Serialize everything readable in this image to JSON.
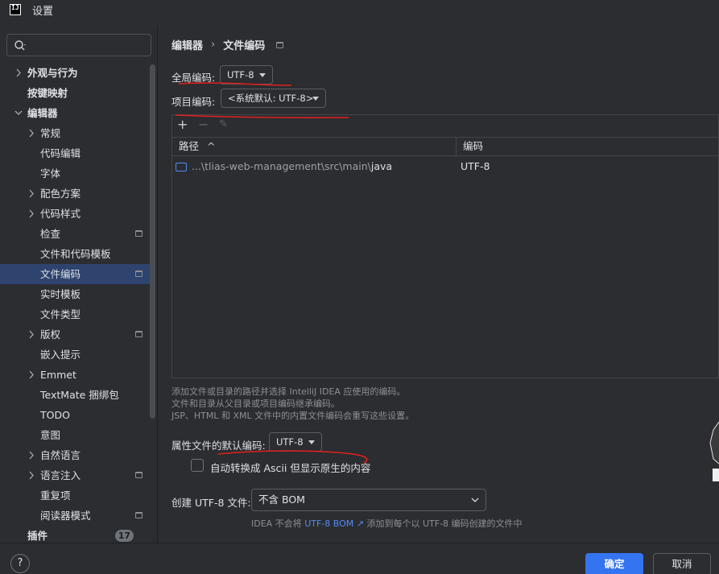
{
  "window": {
    "title": "设置",
    "logo": "IJ"
  },
  "sidebar": {
    "search_placeholder": "",
    "items": [
      {
        "label": "外观与行为",
        "level": 0,
        "arrow": "right",
        "bold": true
      },
      {
        "label": "按键映射",
        "level": 0,
        "arrow": "",
        "bold": true
      },
      {
        "label": "编辑器",
        "level": 0,
        "arrow": "down",
        "bold": true
      },
      {
        "label": "常规",
        "level": 1,
        "arrow": "right"
      },
      {
        "label": "代码编辑",
        "level": 1,
        "arrow": ""
      },
      {
        "label": "字体",
        "level": 1,
        "arrow": ""
      },
      {
        "label": "配色方案",
        "level": 1,
        "arrow": "right"
      },
      {
        "label": "代码样式",
        "level": 1,
        "arrow": "right"
      },
      {
        "label": "检查",
        "level": 1,
        "arrow": "",
        "project_icon": true
      },
      {
        "label": "文件和代码模板",
        "level": 1,
        "arrow": ""
      },
      {
        "label": "文件编码",
        "level": 1,
        "arrow": "",
        "project_icon": true,
        "selected": true
      },
      {
        "label": "实时模板",
        "level": 1,
        "arrow": ""
      },
      {
        "label": "文件类型",
        "level": 1,
        "arrow": ""
      },
      {
        "label": "版权",
        "level": 1,
        "arrow": "right",
        "project_icon": true
      },
      {
        "label": "嵌入提示",
        "level": 1,
        "arrow": ""
      },
      {
        "label": "Emmet",
        "level": 1,
        "arrow": "right"
      },
      {
        "label": "TextMate 捆绑包",
        "level": 1,
        "arrow": ""
      },
      {
        "label": "TODO",
        "level": 1,
        "arrow": ""
      },
      {
        "label": "意图",
        "level": 1,
        "arrow": ""
      },
      {
        "label": "自然语言",
        "level": 1,
        "arrow": "right"
      },
      {
        "label": "语言注入",
        "level": 1,
        "arrow": "right",
        "project_icon": true
      },
      {
        "label": "重复项",
        "level": 1,
        "arrow": ""
      },
      {
        "label": "阅读器模式",
        "level": 1,
        "arrow": "",
        "project_icon": true
      },
      {
        "label": "插件",
        "level": 0,
        "arrow": "",
        "bold": true,
        "badge": "17"
      }
    ]
  },
  "breadcrumb": {
    "parent": "编辑器",
    "separator": "›",
    "current": "文件编码"
  },
  "global_encoding": {
    "label": "全局编码:",
    "value": "UTF-8"
  },
  "project_encoding": {
    "label": "项目编码:",
    "value": "<系统默认: UTF-8>"
  },
  "table": {
    "toolbar": {
      "add": "+",
      "remove": "−",
      "edit": "✎"
    },
    "columns": [
      {
        "label": "路径",
        "sort": "^"
      },
      {
        "label": "编码"
      }
    ],
    "rows": [
      {
        "path_prefix": "...\\tlias-web-management\\src\\main\\",
        "path_last": "java",
        "encoding": "UTF-8"
      }
    ]
  },
  "hints": [
    "添加文件或目录的路径并选择 IntelliJ IDEA 应使用的编码。",
    "文件和目录从父目录或项目编码继承编码。",
    "JSP、HTML 和 XML 文件中的内置文件编码会重写这些设置。"
  ],
  "properties_encoding": {
    "label": "属性文件的默认编码:",
    "value": "UTF-8"
  },
  "ascii_checkbox": {
    "label": "自动转换成 Ascii 但显示原生的内容",
    "checked": false
  },
  "bom": {
    "label": "创建 UTF-8 文件:",
    "value": "不含 BOM",
    "hint_prefix": "IDEA 不会将",
    "hint_link": "UTF-8 BOM ↗",
    "hint_suffix": "添加到每个以 UTF-8 编码创建的文件中"
  },
  "footer": {
    "help": "?",
    "ok": "确定",
    "cancel": "取消"
  },
  "colors": {
    "accent": "#3574f0",
    "selection": "#2e436e",
    "annotation": "#e0201e",
    "link": "#548af7"
  }
}
